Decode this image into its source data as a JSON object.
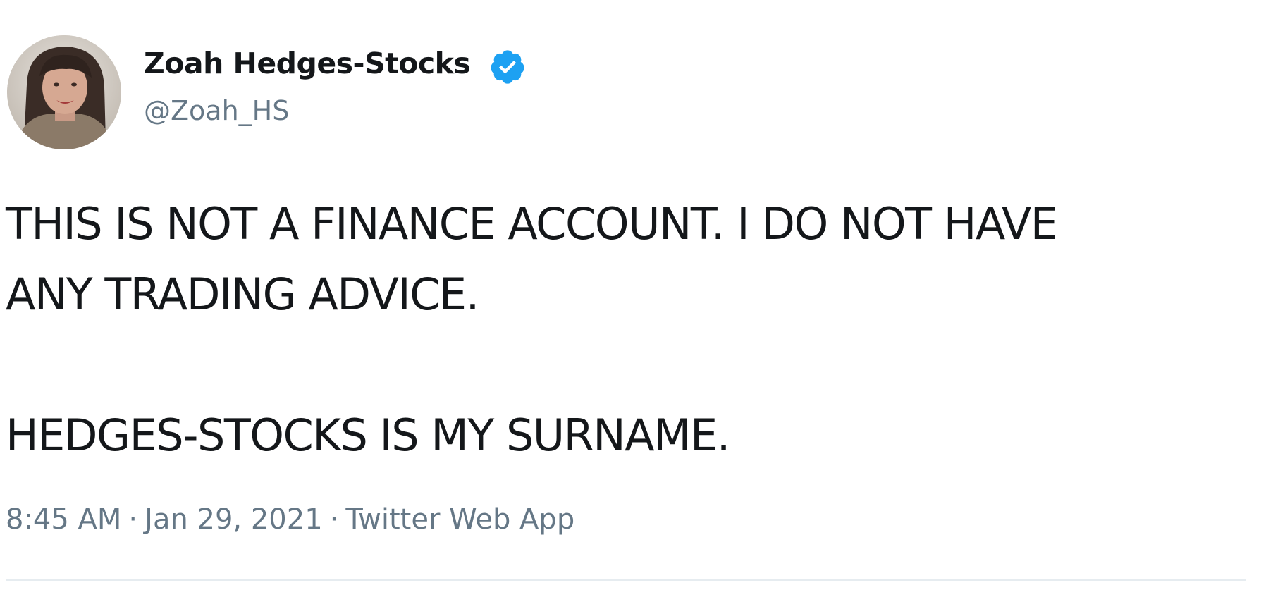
{
  "author": {
    "display_name": "Zoah Hedges-Stocks",
    "handle": "@Zoah_HS",
    "verified": true,
    "verified_color": "#1da1f2",
    "avatar_icon": "profile-photo"
  },
  "tweet": {
    "lines": [
      "THIS IS NOT A FINANCE ACCOUNT. I DO NOT HAVE",
      "ANY TRADING ADVICE.",
      "HEDGES-STOCKS IS MY SURNAME."
    ],
    "time": "8:45 AM",
    "date": "Jan 29, 2021",
    "separator": "·",
    "source": "Twitter Web App"
  },
  "colors": {
    "text_primary": "#14171a",
    "text_secondary": "#657786",
    "divider": "#e6ecf0"
  }
}
